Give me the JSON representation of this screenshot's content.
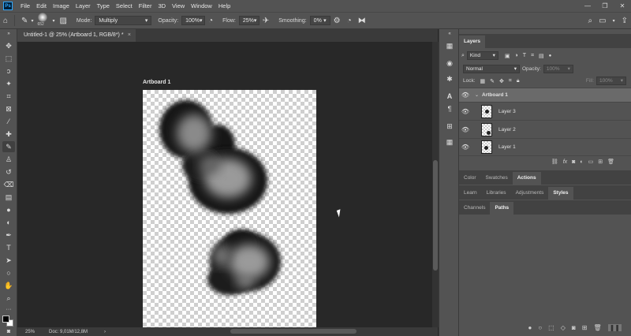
{
  "app": {
    "logo": "Ps"
  },
  "menu": [
    "File",
    "Edit",
    "Image",
    "Layer",
    "Type",
    "Select",
    "Filter",
    "3D",
    "View",
    "Window",
    "Help"
  ],
  "window_controls": [
    "—",
    "❐",
    "✕"
  ],
  "options": {
    "brush_size": "652",
    "mode_label": "Mode:",
    "mode_value": "Multiply",
    "opacity_label": "Opacity:",
    "opacity_value": "100%",
    "flow_label": "Flow:",
    "flow_value": "25%",
    "smoothing_label": "Smoothing:",
    "smoothing_value": "0%"
  },
  "document": {
    "tab_title": "Untitled-1 @ 25% (Artboard 1, RGB/8*) *",
    "close": "×",
    "artboard_label": "Artboard 1"
  },
  "status": {
    "zoom": "25%",
    "doc_info": "Doc: 9,01M/12,8M"
  },
  "layers_panel": {
    "tab": "Layers",
    "filter_label": "Kind",
    "blend_mode": "Normal",
    "opacity_label": "Opacity:",
    "opacity_value": "100%",
    "lock_label": "Lock:",
    "fill_label": "Fill:",
    "fill_value": "100%",
    "group_name": "Artboard 1",
    "layers": [
      "Layer 3",
      "Layer 2",
      "Layer 1"
    ],
    "footer_icons": [
      "link-icon",
      "fx-icon",
      "mask-icon",
      "adjustment-icon",
      "folder-icon",
      "new-layer-icon",
      "trash-icon"
    ]
  },
  "panel_group_2": {
    "tabs": [
      "Color",
      "Swatches",
      "Actions"
    ],
    "active": "Actions"
  },
  "panel_group_3": {
    "tabs": [
      "Learn",
      "Libraries",
      "Adjustments",
      "Styles"
    ],
    "active": "Styles"
  },
  "panel_group_4": {
    "tabs": [
      "Channels",
      "Paths"
    ],
    "active": "Paths"
  },
  "colors": {
    "foreground": "#000000",
    "background": "#ffffff",
    "ui_bg": "#535353",
    "canvas_bg": "#282828"
  }
}
